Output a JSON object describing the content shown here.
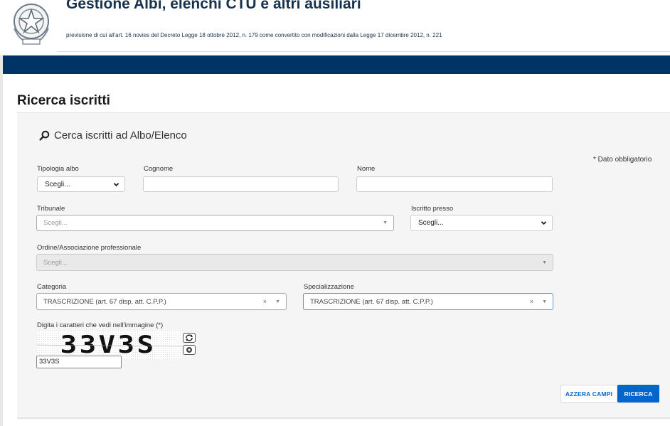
{
  "header": {
    "title": "Gestione Albi, elenchi CTU e altri ausiliari",
    "subtitle": "previsione di cui all'art. 16 novies del Decreto Legge 18 ottobre 2012, n. 179 come convertito con modificazioni dalla Legge 17 dicembre 2012, n. 221",
    "emblem_icon": "italian-republic-emblem-icon"
  },
  "colors": {
    "navbar": "#003366",
    "accent": "#0066cc",
    "title": "#17324d"
  },
  "page": {
    "title": "Ricerca iscritti"
  },
  "search": {
    "heading": "Cerca iscritti ad Albo/Elenco",
    "icon": "search-icon",
    "required_note": "* Dato obbligatorio"
  },
  "form": {
    "tipologia_albo": {
      "label": "Tipologia albo",
      "value": "Scegli..."
    },
    "cognome": {
      "label": "Cognome",
      "value": ""
    },
    "nome": {
      "label": "Nome",
      "value": ""
    },
    "tribunale": {
      "label": "Tribunale",
      "placeholder": "Scegli..."
    },
    "iscritto_presso": {
      "label": "Iscritto presso",
      "value": "Scegli..."
    },
    "ordine": {
      "label": "Ordine/Associazione professionale",
      "placeholder": "Scegli..."
    },
    "categoria": {
      "label": "Categoria",
      "value": "TRASCRIZIONE (art. 67 disp. att. C.P.P.)",
      "clear": "×"
    },
    "specializzazione": {
      "label": "Specializzazione",
      "value": "TRASCRIZIONE (art. 67 disp. att. C.P.P.)",
      "clear": "×"
    },
    "captcha": {
      "label": "Digita i caratteri che vedi nell'immagine (*)",
      "image_text": "33V3S",
      "value": "33V3S",
      "refresh_icon": "refresh-icon",
      "audio_icon": "audio-icon"
    }
  },
  "buttons": {
    "reset": "AZZERA CAMPI",
    "search": "RICERCA"
  }
}
